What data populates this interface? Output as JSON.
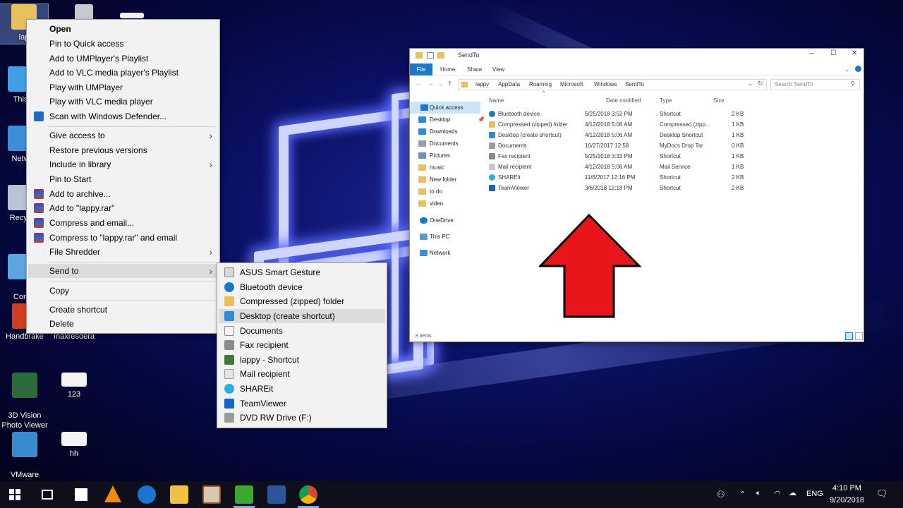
{
  "desktop_icons": [
    {
      "label": "lap"
    },
    {
      "label": "This"
    },
    {
      "label": "Netw"
    },
    {
      "label": "Recyc"
    },
    {
      "label": "Con\nPar"
    },
    {
      "label": "Handbrake"
    },
    {
      "label": "maxresdera"
    },
    {
      "label": "3D Vision\nPhoto Viewer"
    },
    {
      "label": "123"
    },
    {
      "label": "VMware\nWorkstati..."
    },
    {
      "label": "hh"
    }
  ],
  "context_menu": {
    "items": [
      {
        "label": "Open",
        "bold": true
      },
      {
        "label": "Pin to Quick access"
      },
      {
        "label": "Add to UMPlayer's Playlist"
      },
      {
        "label": "Add to VLC media player's Playlist"
      },
      {
        "label": "Play with UMPlayer"
      },
      {
        "label": "Play with VLC media player"
      },
      {
        "label": "Scan with Windows Defender..."
      },
      {
        "label": "Give access to",
        "submenu": true
      },
      {
        "label": "Restore previous versions"
      },
      {
        "label": "Include in library",
        "submenu": true
      },
      {
        "label": "Pin to Start"
      },
      {
        "label": "Add to archive..."
      },
      {
        "label": "Add to \"lappy.rar\""
      },
      {
        "label": "Compress and email..."
      },
      {
        "label": "Compress to \"lappy.rar\" and email"
      },
      {
        "label": "File Shredder",
        "submenu": true
      },
      {
        "label": "Send to",
        "submenu": true,
        "highlighted": true
      },
      {
        "label": "Copy"
      },
      {
        "label": "Create shortcut"
      },
      {
        "label": "Delete"
      }
    ],
    "submenu_arrow": "›"
  },
  "send_to_menu": {
    "items": [
      {
        "label": "ASUS Smart Gesture",
        "icon": "gesture-icon"
      },
      {
        "label": "Bluetooth device",
        "icon": "bluetooth-icon"
      },
      {
        "label": "Compressed (zipped) folder",
        "icon": "zip-folder-icon"
      },
      {
        "label": "Desktop (create shortcut)",
        "icon": "desktop-icon",
        "highlighted": true
      },
      {
        "label": "Documents",
        "icon": "documents-icon"
      },
      {
        "label": "Fax recipient",
        "icon": "fax-icon"
      },
      {
        "label": "lappy - Shortcut",
        "icon": "user-icon"
      },
      {
        "label": "Mail recipient",
        "icon": "mail-icon"
      },
      {
        "label": "SHAREit",
        "icon": "shareit-icon"
      },
      {
        "label": "TeamViewer",
        "icon": "teamviewer-icon"
      },
      {
        "label": "DVD RW Drive (F:)",
        "icon": "dvd-drive-icon"
      }
    ]
  },
  "explorer": {
    "title": "SendTo",
    "ribbon_tabs": [
      "File",
      "Home",
      "Share",
      "View"
    ],
    "breadcrumb": [
      "lappy",
      "AppData",
      "Roaming",
      "Microsoft",
      "Windows",
      "SendTo"
    ],
    "search_placeholder": "Search SendTo",
    "columns": [
      "Name",
      "Date modified",
      "Type",
      "Size"
    ],
    "nav": [
      {
        "label": "Quick access"
      },
      {
        "label": "Desktop"
      },
      {
        "label": "Downloads"
      },
      {
        "label": "Documents"
      },
      {
        "label": "Pictures"
      },
      {
        "label": "music"
      },
      {
        "label": "New folder"
      },
      {
        "label": "to do"
      },
      {
        "label": "video"
      },
      {
        "label": "OneDrive"
      },
      {
        "label": "This PC"
      },
      {
        "label": "Network"
      }
    ],
    "files": [
      {
        "name": "Bluetooth device",
        "date": "5/25/2018 3:52 PM",
        "type": "Shortcut",
        "size": "2 KB"
      },
      {
        "name": "Compressed (zipped) folder",
        "date": "4/12/2018 5:06 AM",
        "type": "Compressed (zipp...",
        "size": "1 KB"
      },
      {
        "name": "Desktop (create shortcut)",
        "date": "4/12/2018 5:06 AM",
        "type": "Desktop Shortcut",
        "size": "1 KB"
      },
      {
        "name": "Documents",
        "date": "10/27/2017 12:58",
        "type": "MyDocs Drop Tar",
        "size": "0 KB"
      },
      {
        "name": "Fax recipient",
        "date": "5/25/2018 3:33 PM",
        "type": "Shortcut",
        "size": "1 KB"
      },
      {
        "name": "Mail recipient",
        "date": "4/12/2018 5:06 AM",
        "type": "Mail Service",
        "size": "1 KB"
      },
      {
        "name": "SHAREit",
        "date": "11/6/2017 12:16 PM",
        "type": "Shortcut",
        "size": "2 KB"
      },
      {
        "name": "TeamViewer",
        "date": "3/6/2018 12:18 PM",
        "type": "Shortcut",
        "size": "2 KB"
      }
    ],
    "status": "8 items",
    "window_controls": [
      "─",
      "☐",
      "✕"
    ]
  },
  "taskbar": {
    "apps": [
      "windows-start-icon",
      "task-view-icon",
      "store-icon",
      "vlc-icon",
      "edge-icon",
      "file-explorer-icon",
      "paint-icon",
      "camtasia-icon",
      "word-icon",
      "chrome-icon"
    ],
    "language": "ENG",
    "time": "4:10 PM",
    "date": "9/20/2018"
  },
  "colors": {
    "arrow": "#e8151b",
    "highlight": "#dcdcdc",
    "ribbon_file": "#1979ca"
  }
}
